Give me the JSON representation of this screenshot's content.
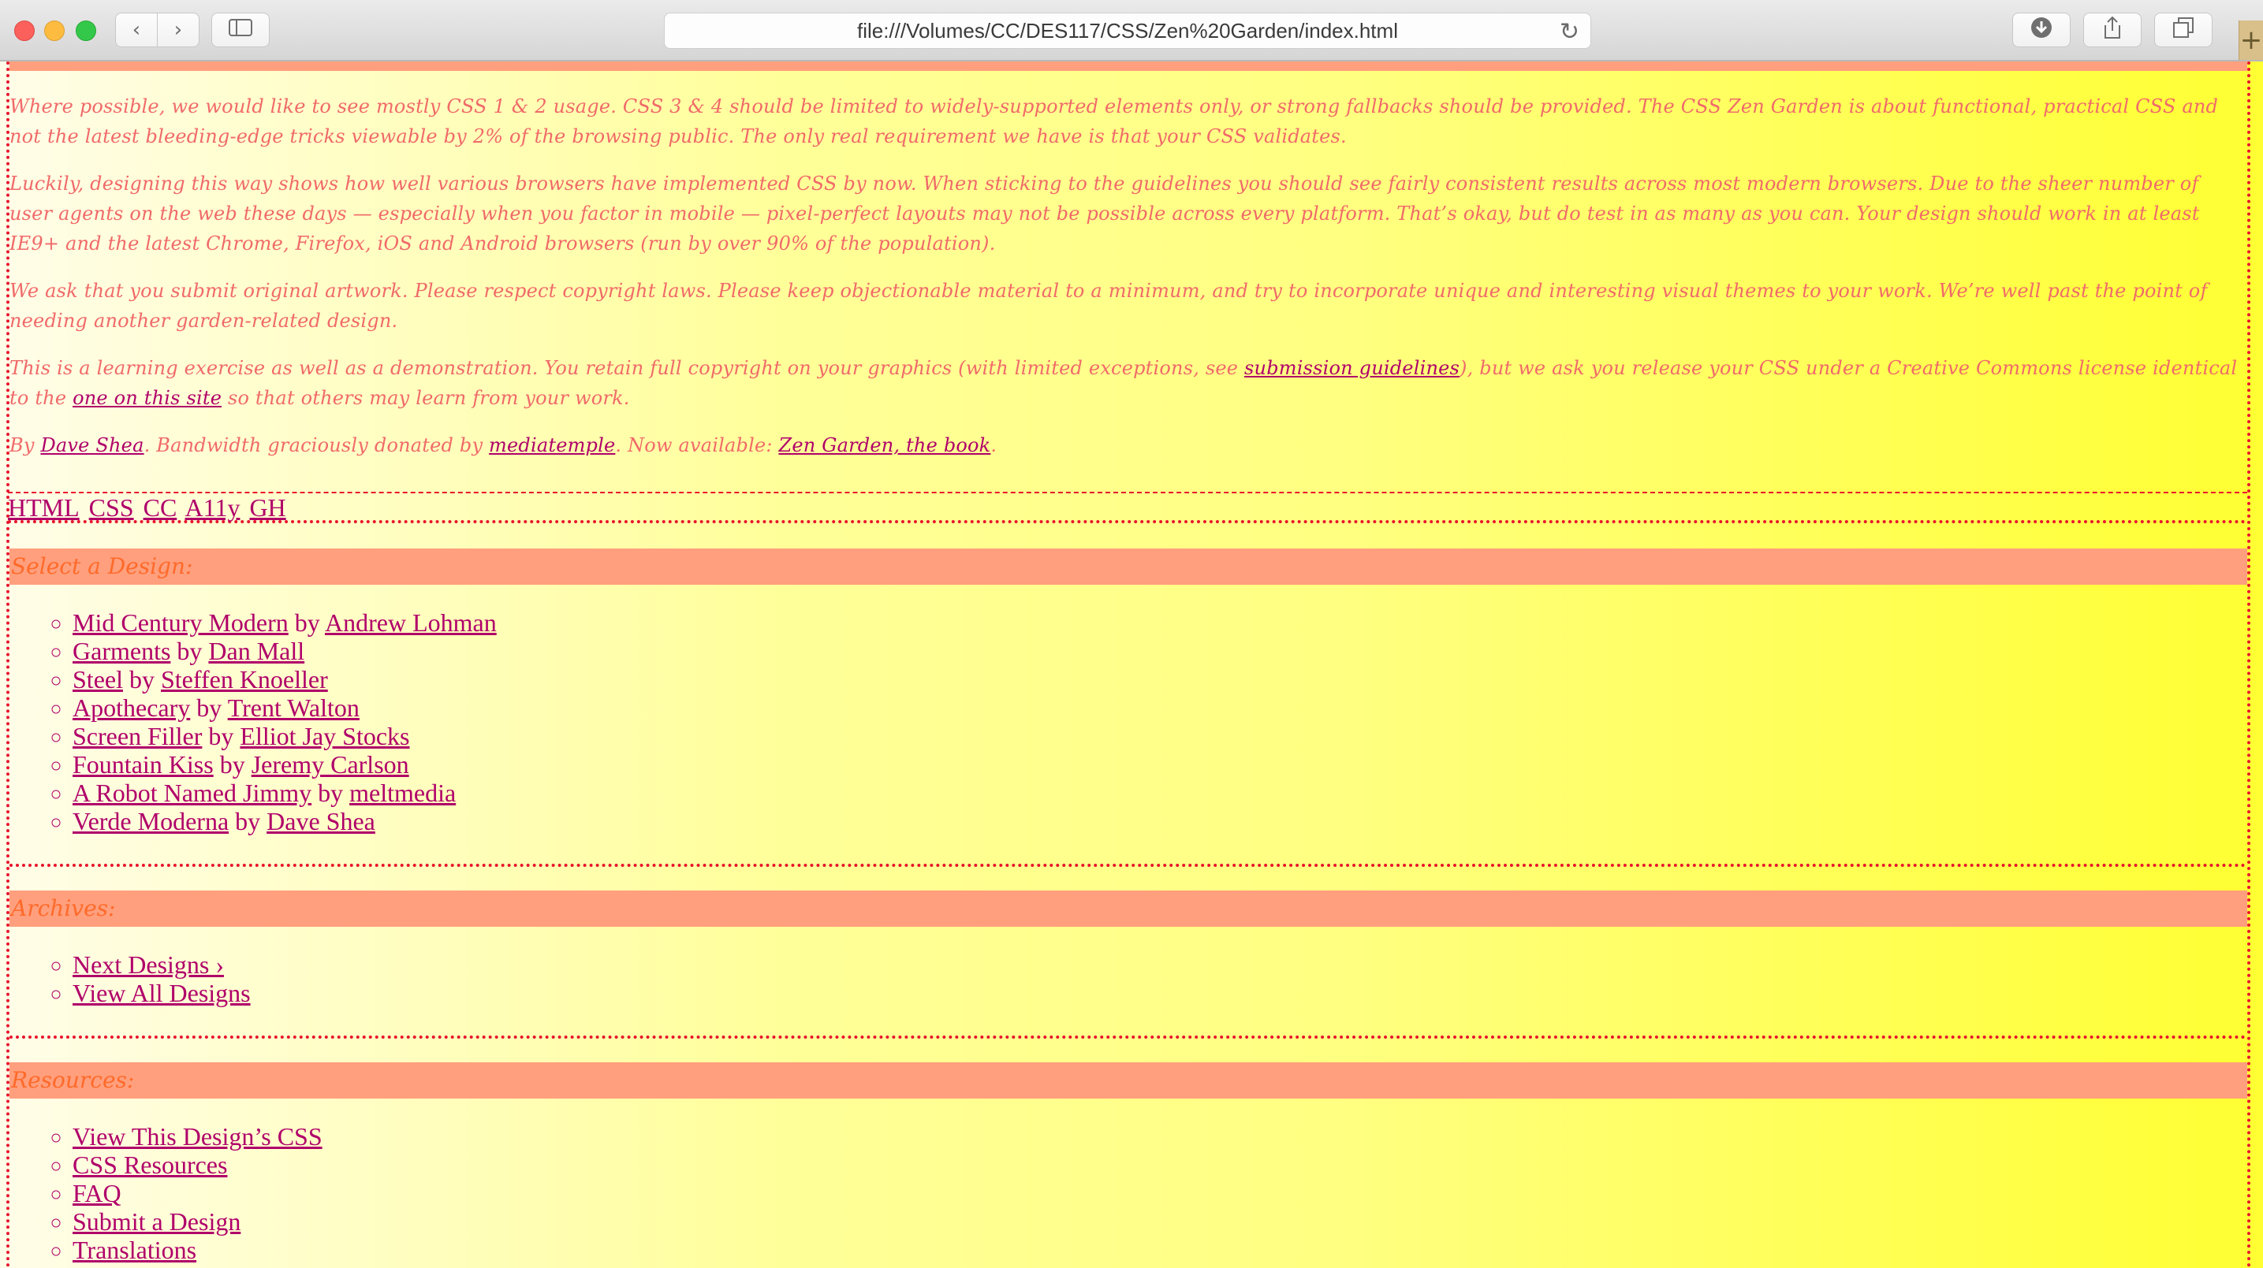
{
  "browser": {
    "url": "file:///Volumes/CC/DES117/CSS/Zen%20Garden/index.html",
    "back_icon": "chevron-left-icon",
    "forward_icon": "chevron-right-icon",
    "sidebar_icon": "sidebar-icon",
    "reload_icon": "reload-icon",
    "download_icon": "download-icon",
    "share_icon": "share-icon",
    "tabs_icon": "tabs-icon",
    "newtab_label": "+"
  },
  "preamble": {
    "p1": "Where possible, we would like to see mostly CSS 1 & 2 usage. CSS 3 & 4 should be limited to widely-supported elements only, or strong fallbacks should be provided. The CSS Zen Garden is about functional, practical CSS and not the latest bleeding-edge tricks viewable by 2% of the browsing public. The only real requirement we have is that your CSS validates.",
    "p2": "Luckily, designing this way shows how well various browsers have implemented CSS by now. When sticking to the guidelines you should see fairly consistent results across most modern browsers. Due to the sheer number of user agents on the web these days — especially when you factor in mobile — pixel-perfect layouts may not be possible across every platform. That’s okay, but do test in as many as you can. Your design should work in at least IE9+ and the latest Chrome, Firefox, iOS and Android browsers (run by over 90% of the population).",
    "p3": "We ask that you submit original artwork. Please respect copyright laws. Please keep objectionable material to a minimum, and try to incorporate unique and interesting visual themes to your work. We’re well past the point of needing another garden-related design.",
    "p4_pre": "This is a learning exercise as well as a demonstration. You retain full copyright on your graphics (with limited exceptions, see ",
    "p4_link1": "submission guidelines",
    "p4_mid": "), but we ask you release your CSS under a Creative Commons license identical to the ",
    "p4_link2": "one on this site",
    "p4_post": " so that others may learn from your work.",
    "p5_pre": "By ",
    "p5_link1": "Dave Shea",
    "p5_mid1": ". Bandwidth graciously donated by ",
    "p5_link2": "mediatemple",
    "p5_mid2": ". Now available: ",
    "p5_link3": "Zen Garden, the book",
    "p5_post": "."
  },
  "footer_links": [
    "HTML",
    "CSS",
    "CC",
    "A11y",
    "GH"
  ],
  "select_design": {
    "heading": "Select a Design:",
    "items": [
      {
        "design": "Mid Century Modern",
        "author": "Andrew Lohman"
      },
      {
        "design": "Garments",
        "author": "Dan Mall"
      },
      {
        "design": "Steel",
        "author": "Steffen Knoeller"
      },
      {
        "design": "Apothecary",
        "author": "Trent Walton"
      },
      {
        "design": "Screen Filler",
        "author": "Elliot Jay Stocks"
      },
      {
        "design": "Fountain Kiss",
        "author": "Jeremy Carlson"
      },
      {
        "design": "A Robot Named Jimmy",
        "author": "meltmedia"
      },
      {
        "design": "Verde Moderna",
        "author": "Dave Shea"
      }
    ],
    "by": "by"
  },
  "archives": {
    "heading": "Archives:",
    "items": [
      "Next Designs ›",
      "View All Designs"
    ]
  },
  "resources": {
    "heading": "Resources:",
    "items": [
      "View This Design’s CSS",
      "CSS Resources",
      "FAQ",
      "Submit a Design",
      "Translations"
    ]
  },
  "colors": {
    "accent_link": "#b0006a",
    "band": "#ff9f7d",
    "border": "#e8142c"
  }
}
